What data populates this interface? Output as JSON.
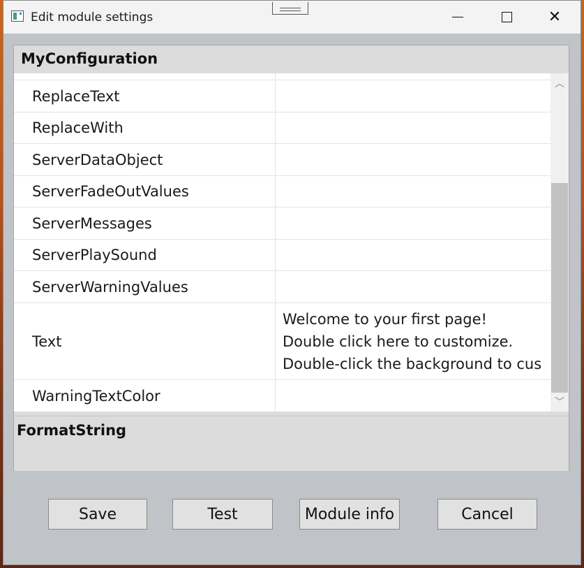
{
  "window": {
    "title": "Edit module settings"
  },
  "section": {
    "header": "MyConfiguration"
  },
  "rows": [
    {
      "name": "ReplaceText",
      "value": ""
    },
    {
      "name": "ReplaceWith",
      "value": ""
    },
    {
      "name": "ServerDataObject",
      "value": ""
    },
    {
      "name": "ServerFadeOutValues",
      "value": ""
    },
    {
      "name": "ServerMessages",
      "value": ""
    },
    {
      "name": "ServerPlaySound",
      "value": ""
    },
    {
      "name": "ServerWarningValues",
      "value": ""
    },
    {
      "name": "Text",
      "value_lines": [
        "Welcome to your first page!",
        "Double click here to customize.",
        "Double-click the background to cus"
      ]
    },
    {
      "name": "WarningTextColor",
      "value": ""
    }
  ],
  "description": {
    "title": "FormatString"
  },
  "buttons": {
    "save": "Save",
    "test": "Test",
    "module_info": "Module info",
    "cancel": "Cancel"
  }
}
